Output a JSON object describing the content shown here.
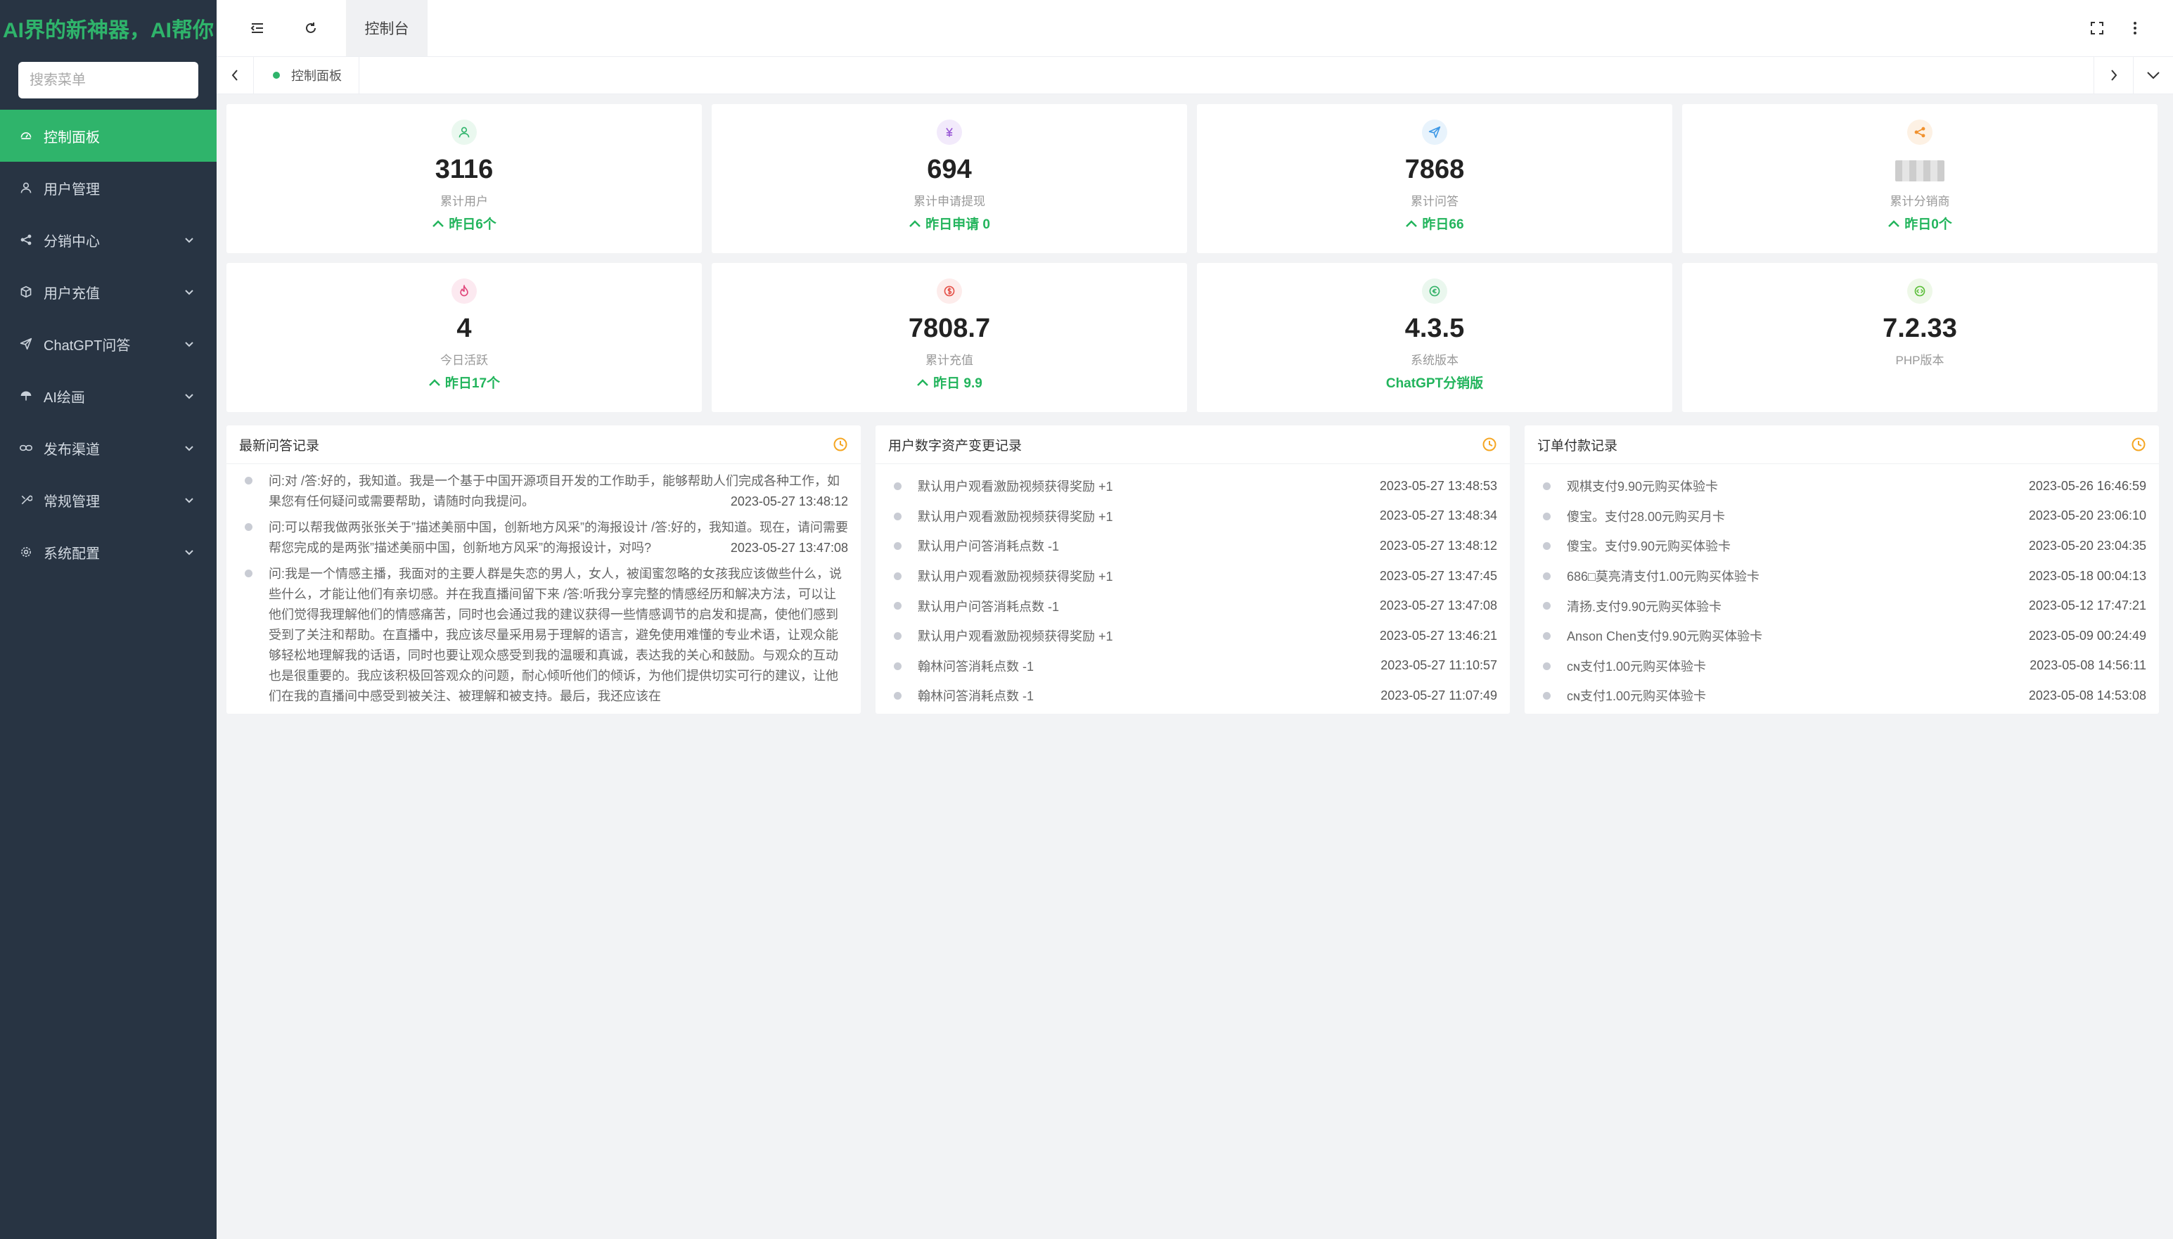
{
  "brand": "AI界的新神器，AI帮你",
  "search": {
    "placeholder": "搜索菜单"
  },
  "menu": [
    {
      "label": "控制面板",
      "icon": "dashboard-icon",
      "active": true,
      "arrow": false
    },
    {
      "label": "用户管理",
      "icon": "user-icon",
      "arrow": false
    },
    {
      "label": "分销中心",
      "icon": "share-icon",
      "arrow": true
    },
    {
      "label": "用户充值",
      "icon": "box-icon",
      "arrow": true
    },
    {
      "label": "ChatGPT问答",
      "icon": "send-icon",
      "arrow": true
    },
    {
      "label": "AI绘画",
      "icon": "umbrella-icon",
      "arrow": true
    },
    {
      "label": "发布渠道",
      "icon": "link-icon",
      "arrow": true
    },
    {
      "label": "常规管理",
      "icon": "tool-icon",
      "arrow": true
    },
    {
      "label": "系统配置",
      "icon": "gear-icon",
      "arrow": true
    }
  ],
  "topbar": {
    "tab": "控制台"
  },
  "tabstrip": {
    "current": "控制面板"
  },
  "stats": [
    {
      "value": "3116",
      "label": "累计用户",
      "trend": "昨日6个",
      "icon": "user-icon",
      "color": "#2fb46b",
      "bg": "#eaf8ef"
    },
    {
      "value": "694",
      "label": "累计申请提现",
      "trend": "昨日申请 0",
      "icon": "yen-icon",
      "color": "#9a5ad6",
      "bg": "#f2eafb"
    },
    {
      "value": "7868",
      "label": "累计问答",
      "trend": "昨日66",
      "icon": "send-icon",
      "color": "#3d98e6",
      "bg": "#e8f3fc"
    },
    {
      "value": "",
      "label": "累计分销商",
      "trend": "昨日0个",
      "icon": "share-icon",
      "color": "#f0912e",
      "bg": "#fdf1e4",
      "blur": true
    },
    {
      "value": "4",
      "label": "今日活跃",
      "trend": "昨日17个",
      "icon": "fire-icon",
      "color": "#e0457a",
      "bg": "#fce9f0"
    },
    {
      "value": "7808.7",
      "label": "累计充值",
      "trend": "昨日 9.9",
      "icon": "dollar-icon",
      "color": "#e5534b",
      "bg": "#fdeceb"
    },
    {
      "value": "4.3.5",
      "label": "系统版本",
      "trend": "ChatGPT分销版",
      "icon": "version-icon",
      "color": "#36b36a",
      "bg": "#eaf7ee",
      "noArrow": true
    },
    {
      "value": "7.2.33",
      "label": "PHP版本",
      "trend": "",
      "icon": "code-icon",
      "color": "#5cbf3a",
      "bg": "#eef8e8"
    }
  ],
  "panels": {
    "qa": {
      "title": "最新问答记录",
      "items": [
        {
          "text": "问:对 /答:好的，我知道。我是一个基于中国开源项目开发的工作助手，能够帮助人们完成各种工作，如果您有任何疑问或需要帮助，请随时向我提问。",
          "time": "2023-05-27 13:48:12"
        },
        {
          "text": "问:可以帮我做两张张关于”描述美丽中国，创新地方风采”的海报设计 /答:好的，我知道。现在，请问需要帮您完成的是两张”描述美丽中国，创新地方风采”的海报设计，对吗?",
          "time": "2023-05-27 13:47:08"
        },
        {
          "text": "问:我是一个情感主播，我面对的主要人群是失恋的男人，女人，被闺蜜忽略的女孩我应该做些什么，说些什么，才能让他们有亲切感。并在我直播间留下来 /答:听我分享完整的情感经历和解决方法，可以让他们觉得我理解他们的情感痛苦，同时也会通过我的建议获得一些情感调节的启发和提高，使他们感到受到了关注和帮助。在直播中，我应该尽量采用易于理解的语言，避免使用难懂的专业术语，让观众能够轻松地理解我的话语，同时也要让观众感受到我的温暖和真诚，表达我的关心和鼓励。与观众的互动也是很重要的。我应该积极回答观众的问题，耐心倾听他们的倾诉，为他们提供切实可行的建议，让他们在我的直播间中感受到被关注、被理解和被支持。最后，我还应该在",
          "time": ""
        }
      ]
    },
    "assets": {
      "title": "用户数字资产变更记录",
      "items": [
        {
          "text": "默认用户观看激励视频获得奖励 +1",
          "time": "2023-05-27 13:48:53"
        },
        {
          "text": "默认用户观看激励视频获得奖励 +1",
          "time": "2023-05-27 13:48:34"
        },
        {
          "text": "默认用户问答消耗点数 -1",
          "time": "2023-05-27 13:48:12"
        },
        {
          "text": "默认用户观看激励视频获得奖励 +1",
          "time": "2023-05-27 13:47:45"
        },
        {
          "text": "默认用户问答消耗点数 -1",
          "time": "2023-05-27 13:47:08"
        },
        {
          "text": "默认用户观看激励视频获得奖励 +1",
          "time": "2023-05-27 13:46:21"
        },
        {
          "text": "翰林问答消耗点数 -1",
          "time": "2023-05-27 11:10:57"
        },
        {
          "text": "翰林问答消耗点数 -1",
          "time": "2023-05-27 11:07:49"
        }
      ]
    },
    "orders": {
      "title": "订单付款记录",
      "items": [
        {
          "text": "观棋支付9.90元购买体验卡",
          "time": "2023-05-26 16:46:59"
        },
        {
          "text": "傻宝。支付28.00元购买月卡",
          "time": "2023-05-20 23:06:10"
        },
        {
          "text": "傻宝。支付9.90元购买体验卡",
          "time": "2023-05-20 23:04:35"
        },
        {
          "text": "686□莫亮清支付1.00元购买体验卡",
          "time": "2023-05-18 00:04:13"
        },
        {
          "text": "清扬.支付9.90元购买体验卡",
          "time": "2023-05-12 17:47:21"
        },
        {
          "text": "Anson Chen支付9.90元购买体验卡",
          "time": "2023-05-09 00:24:49"
        },
        {
          "text": "ᴄɴ支付1.00元购买体验卡",
          "time": "2023-05-08 14:56:11"
        },
        {
          "text": "ᴄɴ支付1.00元购买体验卡",
          "time": "2023-05-08 14:53:08"
        }
      ]
    }
  },
  "colors": {
    "accent": "#2fb46b",
    "sidebar": "#283443",
    "clock": "#f5a623"
  }
}
